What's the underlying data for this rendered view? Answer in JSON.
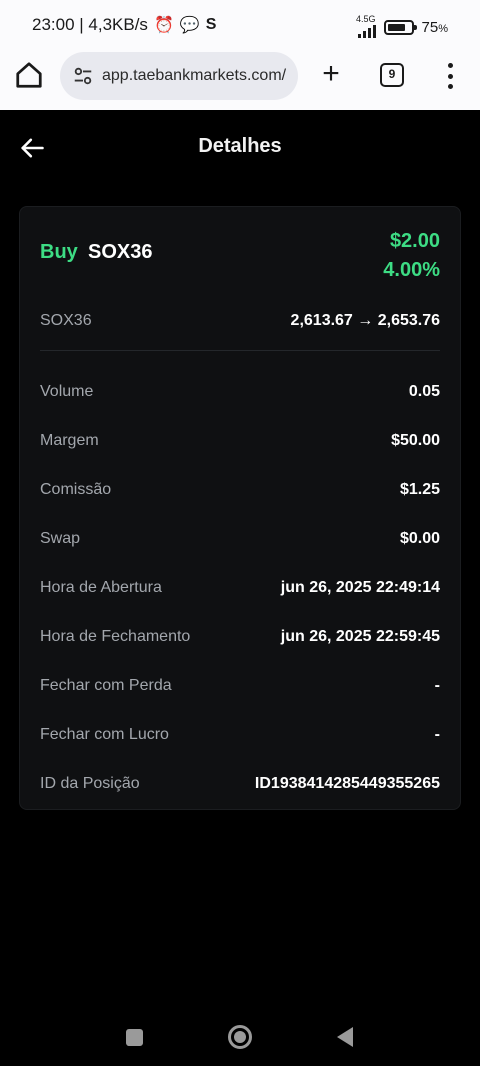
{
  "status_bar": {
    "time_speed": "23:00 | 4,3KB/s",
    "network": "4.5G",
    "battery": "75",
    "battery_unit": "%",
    "battery_level": 0.75,
    "icons": [
      "alarm-icon",
      "chat-icon",
      "s-app-icon",
      "signal-icon",
      "battery-icon"
    ]
  },
  "browser": {
    "url": "app.taebankmarkets.com/",
    "tab_count": "9",
    "icons": [
      "home-icon",
      "site-settings-icon",
      "plus-icon",
      "tabs-icon",
      "more-vert-icon"
    ]
  },
  "header": {
    "title": "Detalhes",
    "back_icon": "arrow-left-icon"
  },
  "trade": {
    "side": "Buy",
    "symbol": "SOX36",
    "pnl_amount": "$2.00",
    "pnl_percent": "4.00%",
    "price_label": "SOX36",
    "price_range": "2,613.67 → 2,653.76",
    "details": [
      {
        "label": "Volume",
        "value": "0.05"
      },
      {
        "label": "Margem",
        "value": "$50.00"
      },
      {
        "label": "Comissão",
        "value": "$1.25"
      },
      {
        "label": "Swap",
        "value": "$0.00"
      },
      {
        "label": "Hora de Abertura",
        "value": "jun 26, 2025 22:49:14"
      },
      {
        "label": "Hora de Fechamento",
        "value": "jun 26, 2025 22:59:45"
      },
      {
        "label": "Fechar com Perda",
        "value": "-"
      },
      {
        "label": "Fechar com Lucro",
        "value": "-"
      },
      {
        "label": "ID da Posição",
        "value": "ID1938414285449355265"
      }
    ]
  },
  "colors": {
    "profit": "#3ddc84",
    "background": "#000000",
    "card": "#0f1012"
  },
  "nav_bar": {
    "icons": [
      "recents-square-icon",
      "home-circle-icon",
      "back-triangle-icon"
    ]
  }
}
